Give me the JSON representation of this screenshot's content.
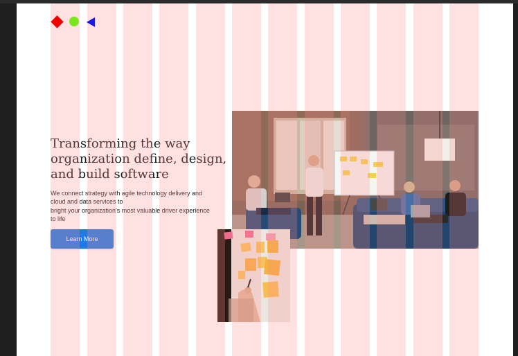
{
  "hero": {
    "title_line1": "Transforming the way",
    "title_line2": "organization define, design,",
    "title_line3": "and build software",
    "description_line1": "We connect strategy with agile technology delivery and",
    "description_line2": "cloud and data services to",
    "description_line3": "bright your organization's most valuable driver experience",
    "description_line4": "to life",
    "cta_label": "Learn More"
  },
  "logo": {
    "shapes": [
      "diamond",
      "circle",
      "triangle"
    ],
    "colors": {
      "diamond": "#f20000",
      "circle": "#7be51e",
      "triangle": "#1717e8"
    }
  },
  "grid_overlay": {
    "columns": 12,
    "color": "#ff8c8c"
  },
  "images": {
    "main": "office-meeting-photo",
    "secondary": "sticky-notes-wall-photo"
  },
  "colors": {
    "accent": "#1e7ae6",
    "background": "#ffffff",
    "frame": "#1f1f1f"
  }
}
